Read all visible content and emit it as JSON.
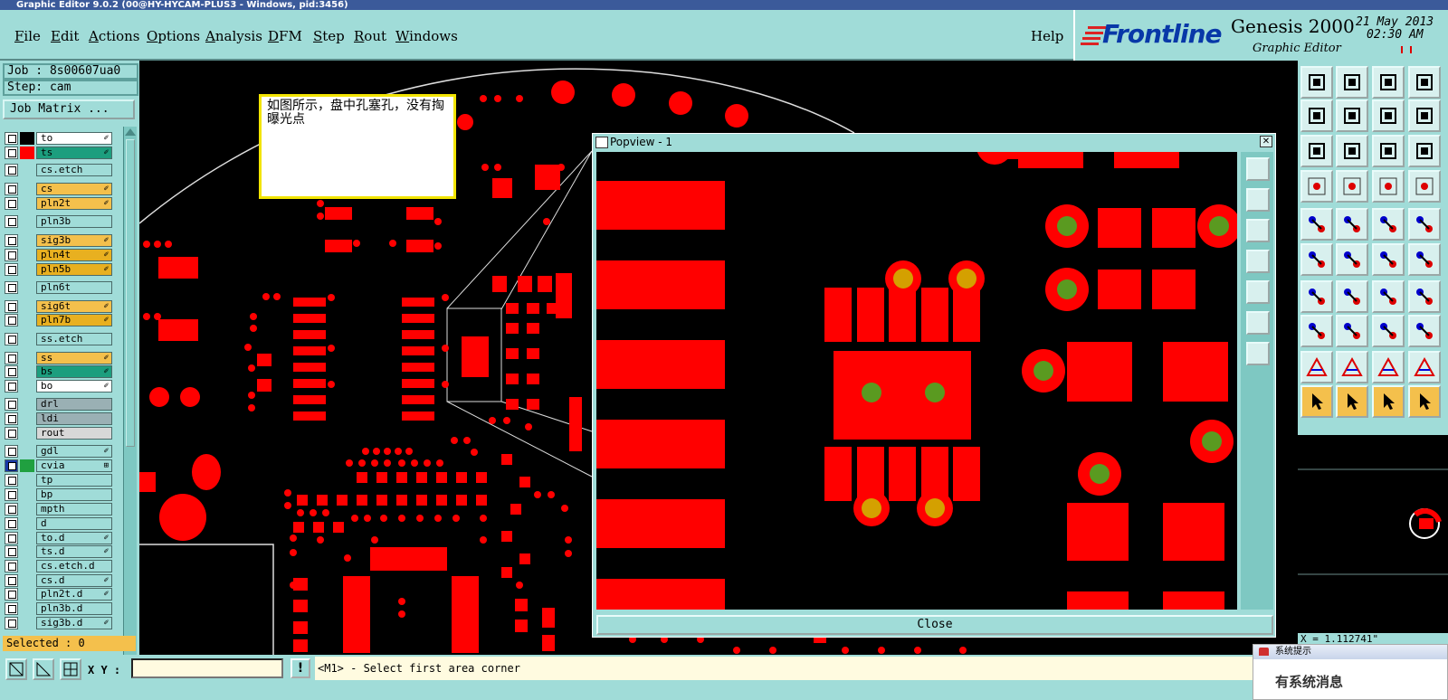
{
  "window": {
    "title": "Graphic Editor 9.0.2 (00@HY-HYCAM-PLUS3 - Windows, pid:3456)"
  },
  "menu": {
    "items": [
      {
        "label": "File",
        "u": "F",
        "rest": "ile"
      },
      {
        "label": "Edit",
        "u": "E",
        "rest": "dit"
      },
      {
        "label": "Actions",
        "u": "A",
        "rest": "ctions"
      },
      {
        "label": "Options",
        "u": "O",
        "rest": "ptions"
      },
      {
        "label": "Analysis",
        "u": "A",
        "rest": "nalysis"
      },
      {
        "label": "DFM",
        "u": "D",
        "rest": "FM"
      },
      {
        "label": "Step",
        "u": "S",
        "rest": "tep"
      },
      {
        "label": "Rout",
        "u": "R",
        "rest": "out"
      },
      {
        "label": "Windows",
        "u": "W",
        "rest": "indows"
      }
    ],
    "help": "Help"
  },
  "brand": {
    "logo": "Frontline",
    "product": "Genesis 2000",
    "module": "Graphic Editor",
    "date": "21 May 2013",
    "time": "02:30 AM"
  },
  "job": {
    "job_label": "Job : 8s00607ua0",
    "step_label": "Step: cam",
    "matrix_button": "Job Matrix ..."
  },
  "layers": [
    {
      "name": "to",
      "color": "#ffffff",
      "swatch": "#000000",
      "mark": "✐"
    },
    {
      "name": "ts",
      "color": "#1c9e7e",
      "swatch": "#ff0000",
      "mark": "✐"
    },
    {
      "name": "cs.etch",
      "color": "#a0dcd8",
      "swatch": "",
      "mark": ""
    },
    {
      "name": "cs",
      "color": "#f4c04c",
      "swatch": "",
      "mark": "✐"
    },
    {
      "name": "pln2t",
      "color": "#f4c04c",
      "swatch": "",
      "mark": "✐"
    },
    {
      "name": "pln3b",
      "color": "#a0dcd8",
      "swatch": "",
      "mark": ""
    },
    {
      "name": "sig3b",
      "color": "#f4c04c",
      "swatch": "",
      "mark": "✐"
    },
    {
      "name": "pln4t",
      "color": "#e8b020",
      "swatch": "",
      "mark": "✐"
    },
    {
      "name": "pln5b",
      "color": "#e8b020",
      "swatch": "",
      "mark": "✐"
    },
    {
      "name": "pln6t",
      "color": "#a0dcd8",
      "swatch": "",
      "mark": ""
    },
    {
      "name": "sig6t",
      "color": "#f4c04c",
      "swatch": "",
      "mark": "✐"
    },
    {
      "name": "pln7b",
      "color": "#e8b020",
      "swatch": "",
      "mark": "✐"
    },
    {
      "name": "ss.etch",
      "color": "#a0dcd8",
      "swatch": "",
      "mark": ""
    },
    {
      "name": "ss",
      "color": "#f4c04c",
      "swatch": "",
      "mark": "✐"
    },
    {
      "name": "bs",
      "color": "#1c9e7e",
      "swatch": "",
      "mark": "✐"
    },
    {
      "name": "bo",
      "color": "#ffffff",
      "swatch": "",
      "mark": "✐"
    },
    {
      "name": "drl",
      "color": "#9ab0b4",
      "swatch": "",
      "mark": ""
    },
    {
      "name": "ldi",
      "color": "#9ab0b4",
      "swatch": "",
      "mark": ""
    },
    {
      "name": "rout",
      "color": "#d8d8d8",
      "swatch": "",
      "mark": ""
    },
    {
      "name": "gdl",
      "color": "#a0dcd8",
      "swatch": "",
      "mark": "✐"
    },
    {
      "name": "cvia",
      "color": "#a0dcd8",
      "swatch": "#20a040",
      "mark": "⊞"
    },
    {
      "name": "tp",
      "color": "#a0dcd8",
      "swatch": "",
      "mark": ""
    },
    {
      "name": "bp",
      "color": "#a0dcd8",
      "swatch": "",
      "mark": ""
    },
    {
      "name": "mpth",
      "color": "#a0dcd8",
      "swatch": "",
      "mark": ""
    },
    {
      "name": "d",
      "color": "#a0dcd8",
      "swatch": "",
      "mark": ""
    },
    {
      "name": "to.d",
      "color": "#a0dcd8",
      "swatch": "",
      "mark": "✐"
    },
    {
      "name": "ts.d",
      "color": "#a0dcd8",
      "swatch": "",
      "mark": "✐"
    },
    {
      "name": "cs.etch.d",
      "color": "#a0dcd8",
      "swatch": "",
      "mark": ""
    },
    {
      "name": "cs.d",
      "color": "#a0dcd8",
      "swatch": "",
      "mark": "✐"
    },
    {
      "name": "pln2t.d",
      "color": "#a0dcd8",
      "swatch": "",
      "mark": "✐"
    },
    {
      "name": "pln3b.d",
      "color": "#a0dcd8",
      "swatch": "",
      "mark": ""
    },
    {
      "name": "sig3b.d",
      "color": "#a0dcd8",
      "swatch": "",
      "mark": "✐"
    }
  ],
  "status": {
    "selected": "Selected : 0",
    "xy_label": "X Y :",
    "xy_value": "",
    "prompt": "<M1> - Select first area corner",
    "coord": "X = 1.112741\""
  },
  "note": {
    "text": "如图所示，盘中孔塞孔，没有掏曝光点"
  },
  "popview": {
    "title": "Popview - 1",
    "close_label": "Close"
  },
  "notice": {
    "title": "系统提示",
    "body": "有系统消息"
  },
  "colors": {
    "panel": "#a0dcd8",
    "pad": "#ff0000",
    "drill_ring": "#d4a000",
    "via_center": "#5a9a20"
  }
}
